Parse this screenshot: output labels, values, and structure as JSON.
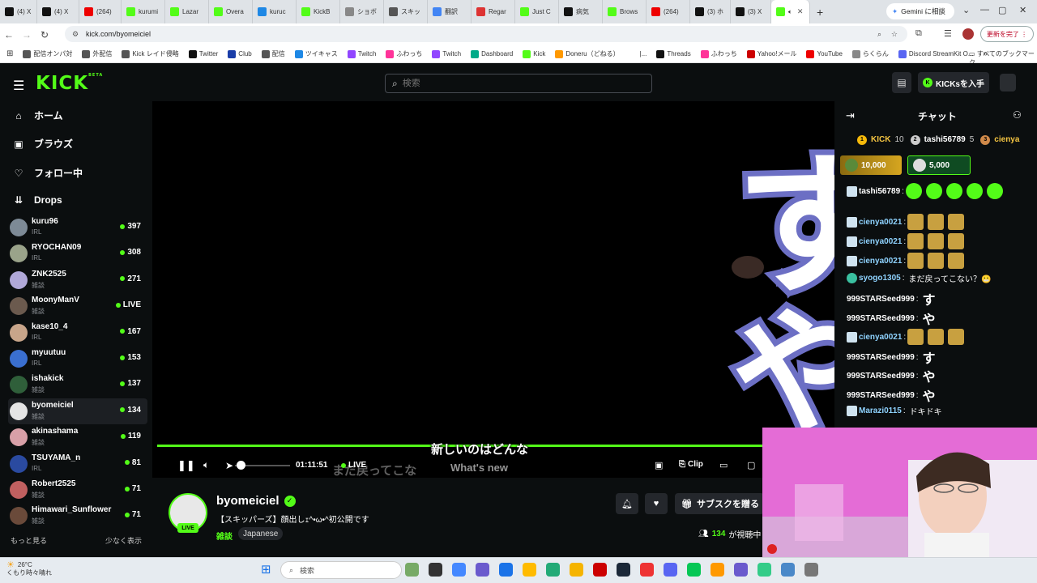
{
  "browser": {
    "tabs": [
      {
        "label": "(4) X",
        "color": "#111"
      },
      {
        "label": "(4) X",
        "color": "#111"
      },
      {
        "label": "(264)",
        "color": "#e00"
      },
      {
        "label": "kurumi",
        "color": "#53fc18"
      },
      {
        "label": "Lazar",
        "color": "#53fc18"
      },
      {
        "label": "Overa",
        "color": "#53fc18"
      },
      {
        "label": "kuruc",
        "color": "#1e88e5"
      },
      {
        "label": "KickB",
        "color": "#53fc18"
      },
      {
        "label": "ショボ",
        "color": "#888"
      },
      {
        "label": "スキッ",
        "color": "#555"
      },
      {
        "label": "翻訳",
        "color": "#4285f4"
      },
      {
        "label": "Regar",
        "color": "#d33"
      },
      {
        "label": "Just C",
        "color": "#53fc18"
      },
      {
        "label": "病気",
        "color": "#111"
      },
      {
        "label": "Brows",
        "color": "#53fc18"
      },
      {
        "label": "(264)",
        "color": "#e00"
      },
      {
        "label": "(3) ホ",
        "color": "#111"
      },
      {
        "label": "(3) X",
        "color": "#111"
      }
    ],
    "active_tab_label": "",
    "gemini_tab": "Gemini に相談",
    "url": "kick.com/byomeiciel",
    "update_button": "更新を完了 ⋮",
    "bookmarks": [
      {
        "label": "配信オンパ対",
        "color": "#555"
      },
      {
        "label": "外配信",
        "color": "#555"
      },
      {
        "label": "Kick レイド侵略",
        "color": "#555"
      },
      {
        "label": "Twitter",
        "color": "#111"
      },
      {
        "label": "Club",
        "color": "#1a3da8"
      },
      {
        "label": "配信",
        "color": "#555"
      },
      {
        "label": "ツイキャス",
        "color": "#1e88e5"
      },
      {
        "label": "Twitch",
        "color": "#9146ff"
      },
      {
        "label": "ふわっち",
        "color": "#f39"
      },
      {
        "label": "Twitch",
        "color": "#9146ff"
      },
      {
        "label": "Dashboard",
        "color": "#0a8"
      },
      {
        "label": "Kick",
        "color": "#53fc18"
      },
      {
        "label": "Doneru（どねる）",
        "color": "#f90"
      },
      {
        "label": "|...",
        "color": "#fff"
      },
      {
        "label": "Threads",
        "color": "#111"
      },
      {
        "label": "ふわっち",
        "color": "#f39"
      },
      {
        "label": "Yahoo!メール",
        "color": "#c00"
      },
      {
        "label": "YouTube",
        "color": "#e00"
      },
      {
        "label": "らくらん",
        "color": "#888"
      },
      {
        "label": "Discord StreamKit O...",
        "color": "#5865f2"
      }
    ],
    "all_bookmarks": "すべてのブックマーク"
  },
  "kick": {
    "logo": "KICK",
    "logo_beta": "BETA",
    "search_placeholder": "検索",
    "get_kicks": "KICKsを入手"
  },
  "sidebar": {
    "nav": [
      {
        "label": "ホーム",
        "icon": "home-icon",
        "glyph": "⌂"
      },
      {
        "label": "ブラウズ",
        "icon": "browse-icon",
        "glyph": "▣"
      },
      {
        "label": "フォロー中",
        "icon": "heart-icon",
        "glyph": "♡"
      },
      {
        "label": "Drops",
        "icon": "drops-icon",
        "glyph": "⇊"
      }
    ],
    "channels": [
      {
        "name": "kuru96",
        "category": "IRL",
        "viewers": "397",
        "color": "#7d8a96"
      },
      {
        "name": "RYOCHAN09",
        "category": "IRL",
        "viewers": "308",
        "color": "#9aa38a"
      },
      {
        "name": "ZNK2525",
        "category": "雑談",
        "viewers": "271",
        "color": "#b0a8d8"
      },
      {
        "name": "MoonyManV",
        "category": "雑談",
        "viewers": "LIVE",
        "color": "#6b5a4e"
      },
      {
        "name": "kase10_4",
        "category": "IRL",
        "viewers": "167",
        "color": "#c8a58a"
      },
      {
        "name": "myuutuu",
        "category": "IRL",
        "viewers": "153",
        "color": "#3a6fd0"
      },
      {
        "name": "ishakick",
        "category": "雑談",
        "viewers": "137",
        "color": "#2f5f3a"
      },
      {
        "name": "byomeiciel",
        "category": "雑談",
        "viewers": "134",
        "color": "#e4e4e4"
      },
      {
        "name": "akinashama",
        "category": "雑談",
        "viewers": "119",
        "color": "#d8a0a8"
      },
      {
        "name": "TSUYAMA_n",
        "category": "IRL",
        "viewers": "81",
        "color": "#2a4aa0"
      },
      {
        "name": "Robert2525",
        "category": "雑談",
        "viewers": "71",
        "color": "#c06060"
      },
      {
        "name": "Himawari_Sunflower",
        "category": "雑談",
        "viewers": "71",
        "color": "#6a4a3a"
      }
    ],
    "show_more": "もっと見る",
    "show_less": "少なく表示"
  },
  "player": {
    "time": "01:11:51",
    "live": "LIVE",
    "clip": "Clip",
    "subtitle_line1": "新しいのはどんな",
    "subtitle_line2": "まだ戻ってこな",
    "subtitle_line3": "What's new",
    "video_chars": [
      "す",
      "や"
    ],
    "progress": 1.0,
    "volume": 0.1
  },
  "stream": {
    "channel": "byomeiciel",
    "title": "【スキッパーズ】顔出しｪ^•ω•^初公開です",
    "category": "雑談",
    "language": "Japanese",
    "live_tag": "LIVE",
    "subscribe_gift": "サブスクを贈る",
    "viewers_count": "134",
    "viewers_label": "が視聴中"
  },
  "chat": {
    "title": "チャット",
    "leaderboard": [
      {
        "rank": "1",
        "name": "KICK",
        "score": "10",
        "rank_color": "#f5b90a",
        "name_color": "#f5c542"
      },
      {
        "rank": "2",
        "name": "tashi56789",
        "score": "5",
        "rank_color": "#ccc",
        "name_color": "#fff"
      },
      {
        "rank": "3",
        "name": "cienya",
        "score": "",
        "rank_color": "#d08a4a",
        "name_color": "#f5c542"
      }
    ],
    "gift1_amount": "10,000",
    "gift2_amount": "5,000",
    "messages": [
      {
        "user": "tashi56789",
        "color": "#fff",
        "text": ""
      },
      {
        "user": "cienya0021",
        "color": "#8fd3ff",
        "text": ""
      },
      {
        "user": "cienya0021",
        "color": "#8fd3ff",
        "text": ""
      },
      {
        "user": "cienya0021",
        "color": "#8fd3ff",
        "text": ""
      },
      {
        "user": "syogo1305",
        "color": "#8fd3ff",
        "text": "まだ戻ってこない？😬"
      },
      {
        "user": "999STARSeed999",
        "color": "#fff",
        "text": "す"
      },
      {
        "user": "999STARSeed999",
        "color": "#fff",
        "text": "や"
      },
      {
        "user": "cienya0021",
        "color": "#8fd3ff",
        "text": ""
      },
      {
        "user": "999STARSeed999",
        "color": "#fff",
        "text": "す"
      },
      {
        "user": "999STARSeed999",
        "color": "#fff",
        "text": "や"
      },
      {
        "user": "999STARSeed999",
        "color": "#fff",
        "text": "や"
      },
      {
        "user": "Marazi0115",
        "color": "#8fd3ff",
        "text": "ドキドキ"
      }
    ]
  },
  "taskbar": {
    "temp": "26°C",
    "weather": "くもり時々晴れ",
    "search": "検索"
  }
}
